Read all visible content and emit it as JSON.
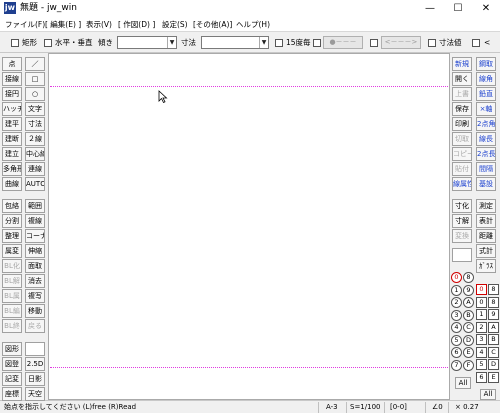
{
  "window": {
    "title": "無題 - jw_win",
    "icon_text": "jw",
    "minimize_glyph": "—",
    "maximize_glyph": "☐",
    "close_glyph": "✕"
  },
  "menu": [
    "ファイル(F)",
    "[ 編集(E) ]",
    "表示(V)",
    "[ 作図(D) ]",
    "設定(S)",
    "[その他(A)]",
    "ヘルプ(H)"
  ],
  "toolbar": {
    "rect_label": "矩形",
    "horizvert_label": "水平・垂直",
    "slope_label": "傾き",
    "slope_value": "",
    "dimension_label": "寸法",
    "dimension_value": "",
    "angle15_label": "15度毎",
    "point_button": "●－－－",
    "arrow_button": "<－－－>",
    "dimvalue_label": "寸法値",
    "lt_label": "<"
  },
  "left_tools": {
    "col1": [
      "点",
      "接線",
      "接円",
      "ハッチ",
      "建平",
      "建断",
      "建立",
      "多角形",
      "曲線",
      "包絡",
      "分割",
      "整理",
      "属変",
      "BL化",
      "BL解",
      "BL属",
      "BL編",
      "BL終",
      "図形",
      "図登",
      "記変",
      "座標"
    ],
    "col2": [
      "／",
      "□",
      "○",
      "文字",
      "寸法",
      "２線",
      "中心線",
      "連線",
      "AUTO",
      "範囲",
      "複線",
      "コーナー",
      "伸縮",
      "面取",
      "消去",
      "複写",
      "移動",
      "戻る",
      "",
      "2.5D",
      "日影",
      "天空"
    ]
  },
  "right_tools": {
    "col1": [
      "新規",
      "開く",
      "上書",
      "保存",
      "印刷",
      "切取",
      "コピー",
      "貼付",
      "線属性",
      "寸化",
      "寸解",
      "変換",
      "",
      "0",
      "0",
      "1",
      "2",
      "3",
      "4",
      "5",
      "6",
      "7",
      "All"
    ],
    "col2": [
      "鋼取",
      "線角",
      "鉛直",
      "×軸",
      "2点角",
      "線長",
      "2点長",
      "間隔",
      "基設",
      "測定",
      "表計",
      "距離",
      "式計",
      "ｶﾞﾗｽ",
      "8",
      "8",
      "9",
      "A",
      "B",
      "C",
      "D",
      "E",
      "F",
      "All"
    ]
  },
  "layer_circles": [
    "0",
    "1",
    "2",
    "3",
    "4",
    "5",
    "6",
    "7",
    "8",
    "9",
    "A",
    "B",
    "C",
    "D",
    "E",
    "F"
  ],
  "status": {
    "message": "始点を指示してください (L)free (R)Read",
    "a_value": "A-3",
    "scale": "S=1/100",
    "layer": "[0-0]",
    "angle": "∠0",
    "zoom": "× 0.27"
  },
  "colors": {
    "paper_frame": "#e03ce0",
    "blue_text": "#1a3fcf",
    "red_text": "#d00000"
  }
}
